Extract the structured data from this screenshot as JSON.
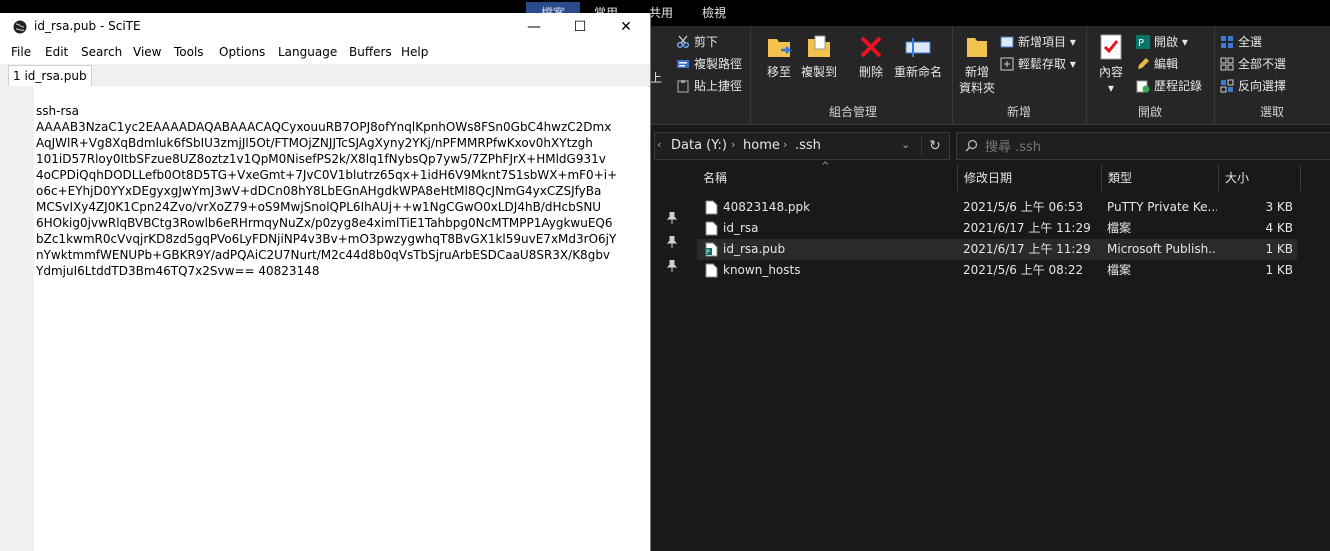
{
  "explorer": {
    "tabs": [
      "檔案",
      "常用",
      "共用",
      "檢視"
    ],
    "ribbon": {
      "groups": {
        "clipboard": "",
        "organize": "組合管理",
        "new": "新增",
        "open": "開啟",
        "select": "選取"
      },
      "clipboard": {
        "cut": "剪下",
        "copy_path": "複製路徑",
        "paste_shortcut": "貼上捷徑",
        "partial_paste": "上"
      },
      "organize": {
        "move_to": "移至",
        "copy_to": "複製到",
        "delete": "刪除",
        "rename": "重新命名"
      },
      "new": {
        "new_folder_line1": "新增",
        "new_folder_line2": "資料夾",
        "new_item": "新增項目",
        "easy_access": "輕鬆存取"
      },
      "open": {
        "properties": "內容",
        "open": "開啟",
        "edit": "編輯",
        "history": "歷程記錄"
      },
      "select": {
        "select_all": "全選",
        "select_none": "全部不選",
        "invert": "反向選擇"
      }
    },
    "address": {
      "drive": "Data (Y:)",
      "folder1": "home",
      "folder2": ".ssh"
    },
    "search": {
      "placeholder": "搜尋 .ssh"
    },
    "columns": {
      "name": "名稱",
      "modified": "修改日期",
      "type": "類型",
      "size": "大小"
    },
    "files": [
      {
        "name": "40823148.ppk",
        "modified": "2021/5/6 上午 06:53",
        "type": "PuTTY Private Ke...",
        "size": "3 KB"
      },
      {
        "name": "id_rsa",
        "modified": "2021/6/17 上午 11:29",
        "type": "檔案",
        "size": "4 KB"
      },
      {
        "name": "id_rsa.pub",
        "modified": "2021/6/17 上午 11:29",
        "type": "Microsoft Publish...",
        "size": "1 KB"
      },
      {
        "name": "known_hosts",
        "modified": "2021/5/6 上午 08:22",
        "type": "檔案",
        "size": "1 KB"
      }
    ]
  },
  "scite": {
    "title": "id_rsa.pub - SciTE",
    "window_controls": {
      "minimize": "—",
      "maximize": "☐",
      "close": "✕"
    },
    "menu": [
      "File",
      "Edit",
      "Search",
      "View",
      "Tools",
      "Options",
      "Language",
      "Buffers",
      "Help"
    ],
    "tab_label": "1 id_rsa.pub",
    "content_lines": [
      "ssh-rsa",
      "AAAAB3NzaC1yc2EAAAADAQABAAACAQCyxouuRB7OPJ8ofYnqlKpnhOWs8FSn0GbC4hwzC2Dmx",
      "AqJWlR+Vg8XqBdmluk6fSbIU3zmjJl5Ot/FTMOjZNJJTcSJAgXyny2YKj/nPFMMRPfwKxov0hXYtzgh",
      "101iD57Rloy0ItbSFzue8UZ8oztz1v1QpM0NisefPS2k/X8lq1fNybsQp7yw5/7ZPhFJrX+HMldG931v",
      "4oCPDiQqhDODLLefb0Ot8D5TG+VxeGmt+7JvC0V1blutrz65qx+1idH6V9Mknt7S1sbWX+mF0+i+",
      "o6c+EYhjD0YYxDEgyxgJwYmJ3wV+dDCn08hY8LbEGnAHgdkWPA8eHtMl8QcJNmG4yxCZSJfyBa",
      "MCSvIXy4ZJ0K1Cpn24Zvo/vrXoZ79+oS9MwjSnolQPL6IhAUj++w1NgCGwO0xLDJ4hB/dHcbSNU",
      "6HOkig0jvwRlqBVBCtg3Rowlb6eRHrmqyNuZx/p0zyg8e4ximlTiE1Tahbpg0NcMTMPP1AygkwuEQ6",
      "bZc1kwmR0cVvqjrKD8zd5gqPVo6LyFDNjiNP4v3Bv+mO3pwzygwhqT8BvGX1kl59uvE7xMd3rO6jY",
      "nYwktmmfWENUPb+GBKR9Y/adPQAiC2U7Nurt/M2c44d8b0qVsTbSjruArbESDCaaU8SR3X/K8gbv",
      "YdmjuI6LtddTD3Bm46TQ7x2Svw== 40823148"
    ],
    "colors": {
      "title_bg": "#ffffff",
      "editor_bg": "#ffffff",
      "margin_bg": "#f0f0f0"
    }
  },
  "icons": {
    "scite_app": "scite-app-icon",
    "cut": "scissors-icon",
    "copy_path": "copy-path-icon",
    "paste_shortcut": "paste-shortcut-icon",
    "move_to": "move-to-folder-icon",
    "copy_to": "copy-to-folder-icon",
    "delete": "delete-x-icon",
    "rename": "rename-icon",
    "new_folder": "new-folder-icon",
    "properties": "properties-check-icon",
    "search": "search-icon",
    "refresh": "refresh-icon",
    "pin": "pin-icon",
    "file": "file-icon"
  },
  "colors": {
    "explorer_bg": "#191919",
    "ribbon_bg": "#262626",
    "selected_row": "#2a2a2a",
    "accent_blue": "#2b4a8c",
    "delete_red": "#e81123"
  }
}
